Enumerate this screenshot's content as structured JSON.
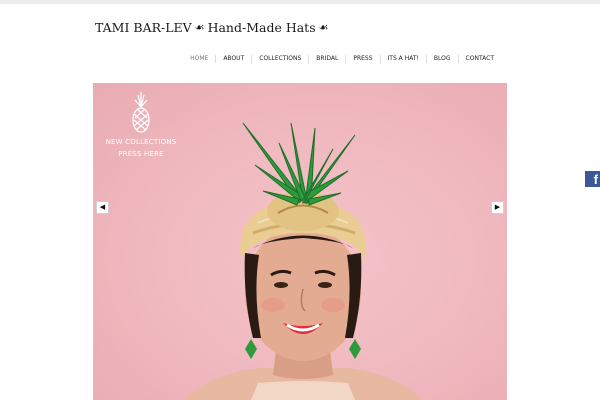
{
  "header": {
    "brand_name": "TAMI BAR-LEV",
    "tagline": "Hand-Made Hats",
    "glyph": "☙"
  },
  "nav": {
    "items": [
      {
        "label": "HOME",
        "active": true
      },
      {
        "label": "ABOUT"
      },
      {
        "label": "COLLECTIONS"
      },
      {
        "label": "BRIDAL"
      },
      {
        "label": "PRESS"
      },
      {
        "label": "ITS A HAT!"
      },
      {
        "label": "BLOG"
      },
      {
        "label": "CONTACT"
      }
    ]
  },
  "hero": {
    "badge_line1": "NEW COLLECTIONS",
    "badge_line2": "PRESS HERE",
    "badge_icon": "pineapple-icon",
    "prev_symbol": "◀",
    "next_symbol": "▶",
    "image_subject": "woman-wearing-pineapple-turban-hat"
  },
  "social": {
    "facebook_symbol": "f",
    "facebook_icon": "facebook-icon"
  },
  "colors": {
    "hero_background": "#efb8be",
    "facebook_blue": "#3b5998",
    "pineapple_green": "#2e9a3c",
    "turban_gold": "#e9cd92",
    "lips": "#e0303f"
  }
}
